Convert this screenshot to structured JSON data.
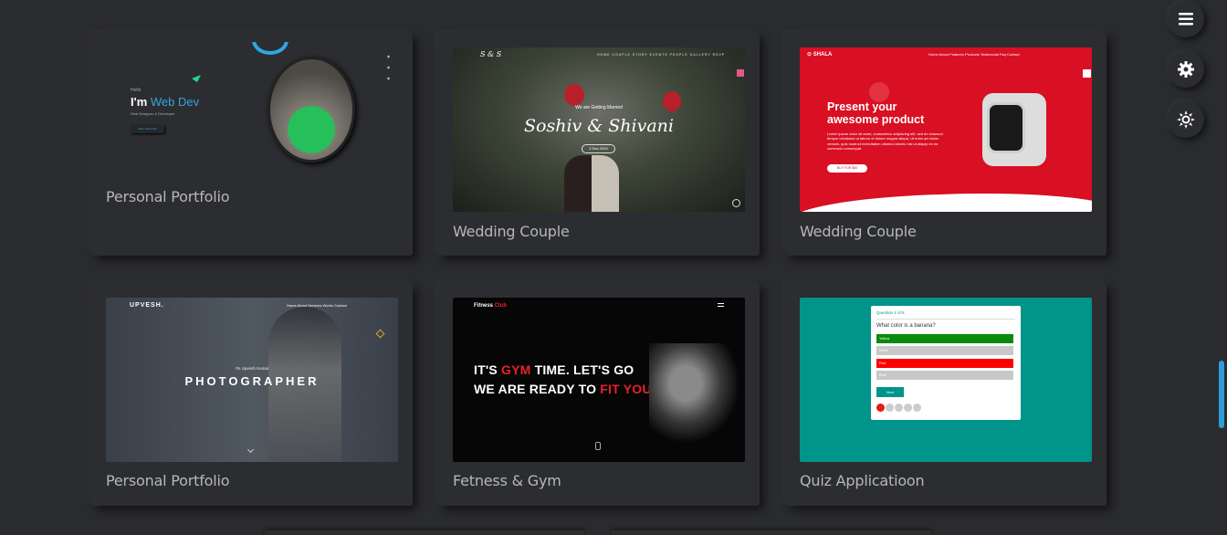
{
  "side_menu": {
    "menu_icon": "hamburger-icon",
    "settings_icon": "gear-icon",
    "theme_icon": "sun-icon"
  },
  "cards": [
    {
      "title": "Personal Portfolio",
      "thumb": {
        "hello": "Hello",
        "im": "I'm ",
        "role": "Web Dev",
        "sub": "Web Designer & Developer",
        "button": "More About Me"
      }
    },
    {
      "title": "Wedding Couple",
      "thumb": {
        "logo": "S & S",
        "nav": "HOME   COUPLE   STORY   EVENTS   PEOPLE   GALLERY   RSVP",
        "getting_married": "We are Getting Married",
        "names": "Soshiv & Shivani",
        "date": "3 Dec 2020"
      }
    },
    {
      "title": "Wedding Couple",
      "thumb": {
        "brand": "⊙ SHALA",
        "nav": "Home   About   Features   Products   Testimonial   Faq   Contact",
        "heading1": "Present your",
        "heading2": "awesome product",
        "paragraph": "Lorem ipsum dolor sit amet, consectetur adipiscing elit, sed do eiusmod tempor incididunt ut labore et dolore magna aliqua. Ut enim ad minim veniam, quis nostrud exercitation ullamco laboris nisi ut aliquip ex ea commodo consequat.",
        "button": "BUY FOR $50"
      }
    },
    {
      "title": "Personal Portfolio",
      "thumb": {
        "brand": "UPVESH.",
        "nav": "Home   About   Services   Works   Contact",
        "small": "I'm Upvesh Kumar",
        "big": "PHOTOGRAPHER"
      }
    },
    {
      "title": "Fetness & Gym",
      "thumb": {
        "brand": "Fitness ",
        "brand_accent": "Club",
        "line1_a": "IT'S ",
        "line1_b": "GYM",
        "line1_c": " TIME. LET'S GO",
        "line2_a": "WE ARE READY TO ",
        "line2_b": "FIT YOU"
      }
    },
    {
      "title": "Quiz Applicatioon",
      "thumb": {
        "question_number": "Question 1 of 5",
        "question": "What color is a banana?",
        "options": [
          "Yellow",
          "White",
          "Red",
          "Blue"
        ],
        "next": "Next"
      }
    }
  ],
  "colors": {
    "background": "#2a2b2e",
    "accent_blue": "#2f9bd9",
    "shala_red": "#d90f23",
    "quiz_teal": "#00948a",
    "gym_red": "#e8202a"
  }
}
